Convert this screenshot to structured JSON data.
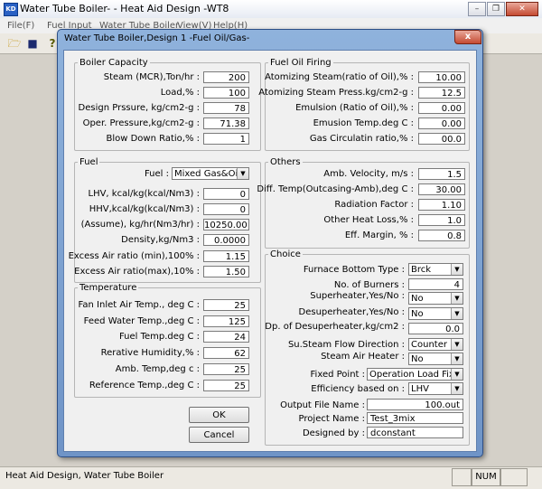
{
  "app": {
    "title": "Water Tube Boiler- - Heat Aid Design -WT8",
    "icon_text": "KD",
    "menu": [
      "File(F)",
      "Fuel Input",
      "Water Tube Boiler",
      "View(V)",
      "Help(H)"
    ],
    "status": "Heat Aid Design, Water Tube Boiler",
    "num": "NUM"
  },
  "dialog": {
    "title": "Water Tube Boiler,Design 1  -Fuel Oil/Gas-",
    "ok": "OK",
    "cancel": "Cancel",
    "close": "x"
  },
  "boiler_capacity": {
    "title": "Boiler Capacity",
    "fields": [
      {
        "label": "Steam (MCR),Ton/hr :",
        "value": "200"
      },
      {
        "label": "Load,% :",
        "value": "100"
      },
      {
        "label": "Design Prssure, kg/cm2-g :",
        "value": "78"
      },
      {
        "label": "Oper. Pressure,kg/cm2-g :",
        "value": "71.38"
      },
      {
        "label": "Blow Down Ratio,% :",
        "value": "1"
      }
    ]
  },
  "fuel": {
    "title": "Fuel",
    "fuel_label": "Fuel :",
    "fuel_value": "Mixed Gas&Oil",
    "fields": [
      {
        "label": "LHV, kcal/kg(kcal/Nm3) :",
        "value": "0"
      },
      {
        "label": "HHV,kcal/kg(kcal/Nm3) :",
        "value": "0"
      },
      {
        "label": "(Assume), kg/hr(Nm3/hr) :",
        "value": "10250.00"
      },
      {
        "label": "Density,kg/Nm3 :",
        "value": "0.0000"
      },
      {
        "label": "Excess Air ratio (min),100% :",
        "value": "1.15"
      },
      {
        "label": "Excess Air ratio(max),10% :",
        "value": "1.50"
      }
    ]
  },
  "temperature": {
    "title": "Temperature",
    "fields": [
      {
        "label": "Fan Inlet Air Temp., deg C :",
        "value": "25"
      },
      {
        "label": "Feed Water Temp.,deg C :",
        "value": "125"
      },
      {
        "label": "Fuel Temp.deg C :",
        "value": "24"
      },
      {
        "label": "Rerative Humidity,% :",
        "value": "62"
      },
      {
        "label": "Amb. Temp,deg c :",
        "value": "25"
      },
      {
        "label": "Reference Temp.,deg C :",
        "value": "25"
      }
    ]
  },
  "fuel_oil_firing": {
    "title": "Fuel Oil Firing",
    "fields": [
      {
        "label": "Atomizing Steam(ratio of Oil),% :",
        "value": "10.00"
      },
      {
        "label": "Atomizing Steam Press.kg/cm2-g :",
        "value": "12.5"
      },
      {
        "label": "Emulsion (Ratio of Oil),% :",
        "value": "0.00"
      },
      {
        "label": "Emusion Temp.deg C :",
        "value": "0.00"
      },
      {
        "label": "Gas Circulatin ratio,% :",
        "value": "00.0"
      }
    ]
  },
  "others": {
    "title": "Others",
    "fields": [
      {
        "label": "Amb. Velocity, m/s :",
        "value": "1.5"
      },
      {
        "label": "Diff. Temp(Outcasing-Amb),deg C :",
        "value": "30.00"
      },
      {
        "label": "Radiation Factor :",
        "value": "1.10"
      },
      {
        "label": "Other Heat Loss,% :",
        "value": "1.0"
      },
      {
        "label": "Eff. Margin, % :",
        "value": "0.8"
      }
    ]
  },
  "choice": {
    "title": "Choice",
    "furnace_bottom_type": {
      "label": "Furnace Bottom Type :",
      "value": "Brck"
    },
    "no_of_burners": {
      "label": "No. of Burners :",
      "value": "4"
    },
    "superheater": {
      "label": "Superheater,Yes/No :",
      "value": "No"
    },
    "desuperheater": {
      "label": "Desuperheater,Yes/No :",
      "value": "No"
    },
    "dp_desuperheater": {
      "label": "Dp. of Desuperheater,kg/cm2 :",
      "value": "0.0"
    },
    "su_steam_flow": {
      "label": "Su.Steam Flow Direction :",
      "value": "Counter"
    },
    "steam_air_heater": {
      "label": "Steam Air Heater :",
      "value": "No"
    },
    "fixed_point": {
      "label": "Fixed Point :",
      "value": "Operation Load Fix."
    },
    "efficiency_based_on": {
      "label": "Efficiency based on :",
      "value": "LHV"
    },
    "output_file_name": {
      "label": "Output File Name :",
      "value": "100.out"
    },
    "project_name": {
      "label": "Project Name :",
      "value": "Test_3mix"
    },
    "designed_by": {
      "label": "Designed by :",
      "value": "dconstant"
    }
  }
}
